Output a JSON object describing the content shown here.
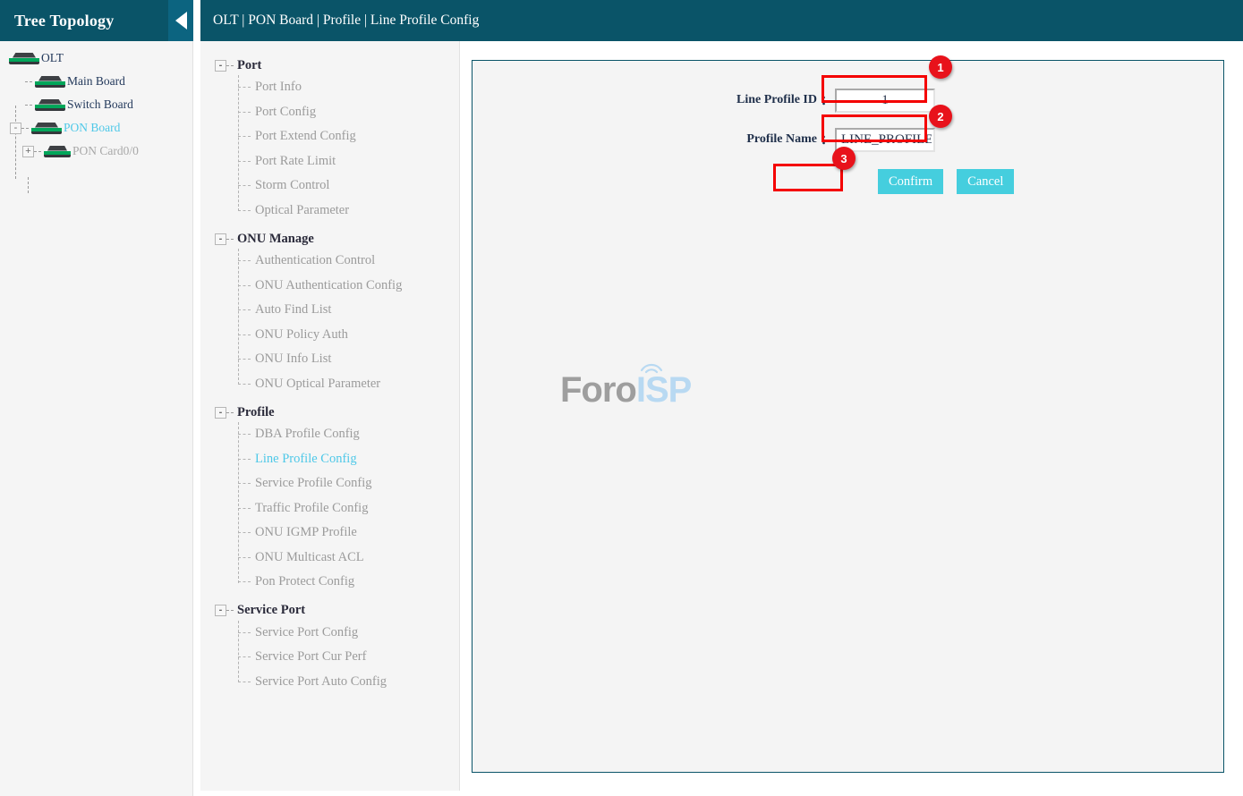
{
  "sidebar": {
    "title": "Tree Topology",
    "collapse_icon": "caret-left-icon",
    "tree": [
      {
        "label": "OLT",
        "state": "dark",
        "icon": "device-icon",
        "expander": ""
      },
      {
        "label": "Main Board",
        "state": "dark",
        "icon": "device-icon",
        "expander": ""
      },
      {
        "label": "Switch Board",
        "state": "dark",
        "icon": "device-icon",
        "expander": ""
      },
      {
        "label": "PON Board",
        "state": "active",
        "icon": "device-icon",
        "expander": "-"
      },
      {
        "label": "PON Card0/0",
        "state": "dim",
        "icon": "device-icon",
        "expander": "+"
      }
    ]
  },
  "topbar": {
    "breadcrumb": "OLT | PON Board | Profile | Line Profile Config"
  },
  "menu": {
    "groups": [
      {
        "label": "Port",
        "expander": "-",
        "items": [
          "Port Info",
          "Port Config",
          "Port Extend Config",
          "Port Rate Limit",
          "Storm Control",
          "Optical Parameter"
        ]
      },
      {
        "label": "ONU Manage",
        "expander": "-",
        "items": [
          "Authentication Control",
          "ONU Authentication Config",
          "Auto Find List",
          "ONU Policy Auth",
          "ONU Info List",
          "ONU Optical Parameter"
        ]
      },
      {
        "label": "Profile",
        "expander": "-",
        "items": [
          "DBA Profile Config",
          "Line Profile Config",
          "Service Profile Config",
          "Traffic Profile Config",
          "ONU IGMP Profile",
          "ONU Multicast ACL",
          "Pon Protect Config"
        ]
      },
      {
        "label": "Service Port",
        "expander": "-",
        "items": [
          "Service Port Config",
          "Service Port Cur Perf",
          "Service Port Auto Config"
        ]
      }
    ],
    "active_item": "Line Profile Config"
  },
  "form": {
    "fields": [
      {
        "label": "Line Profile ID",
        "colon": "：",
        "value": "1",
        "placeholder": ""
      },
      {
        "label": "Profile Name",
        "colon": "：",
        "value": "LINE_PROFILE",
        "placeholder": ""
      }
    ],
    "confirm_label": "Confirm",
    "cancel_label": "Cancel"
  },
  "watermark": {
    "text_primary": "Foro",
    "text_secondary": "ISP"
  },
  "annotations": {
    "badges": [
      "1",
      "2",
      "3"
    ]
  },
  "colors": {
    "header_teal": "#0a5468",
    "accent_cyan": "#4ec8e8",
    "button_cyan": "#45cede",
    "annotation_red": "#e8121b",
    "highlight_red": "#f40000"
  }
}
